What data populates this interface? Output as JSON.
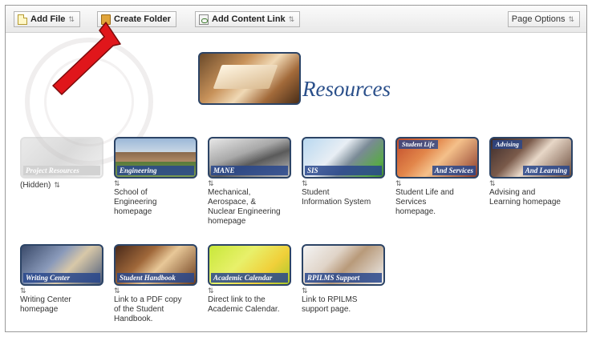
{
  "toolbar": {
    "add_file": "Add File",
    "create_folder": "Create Folder",
    "add_content_link": "Add Content Link",
    "page_options": "Page Options",
    "caret": "⇅"
  },
  "page": {
    "title": "Resources"
  },
  "tiles": [
    {
      "caption": "Project Resources",
      "desc": "(Hidden)"
    },
    {
      "caption": "Engineering",
      "desc": "School of\nEngineering\nhomepage"
    },
    {
      "caption": "MANE",
      "desc": "Mechanical,\nAerospace, &\nNuclear Engineering\nhomepage"
    },
    {
      "caption": "SIS",
      "desc": "Student\nInformation System"
    },
    {
      "caption_top": "Student Life",
      "caption": "And Services",
      "desc": "Student Life and\nServices\nhomepage."
    },
    {
      "caption_top": "Advising",
      "caption": "And Learning",
      "desc": "Advising and\nLearning homepage"
    },
    {
      "caption": "Writing Center",
      "desc": "Writing Center\nhomepage"
    },
    {
      "caption": "Student Handbook",
      "desc": "Link to a PDF copy\nof the Student\nHandbook."
    },
    {
      "caption": "Academic Calendar",
      "desc": "Direct link to the\nAcademic Calendar."
    },
    {
      "caption": "RPILMS Support",
      "desc": "Link to RPILMS\nsupport page."
    }
  ],
  "colors": {
    "accent": "#2a4f8a",
    "arrow": "#e0161b",
    "border": "#2c4466"
  }
}
